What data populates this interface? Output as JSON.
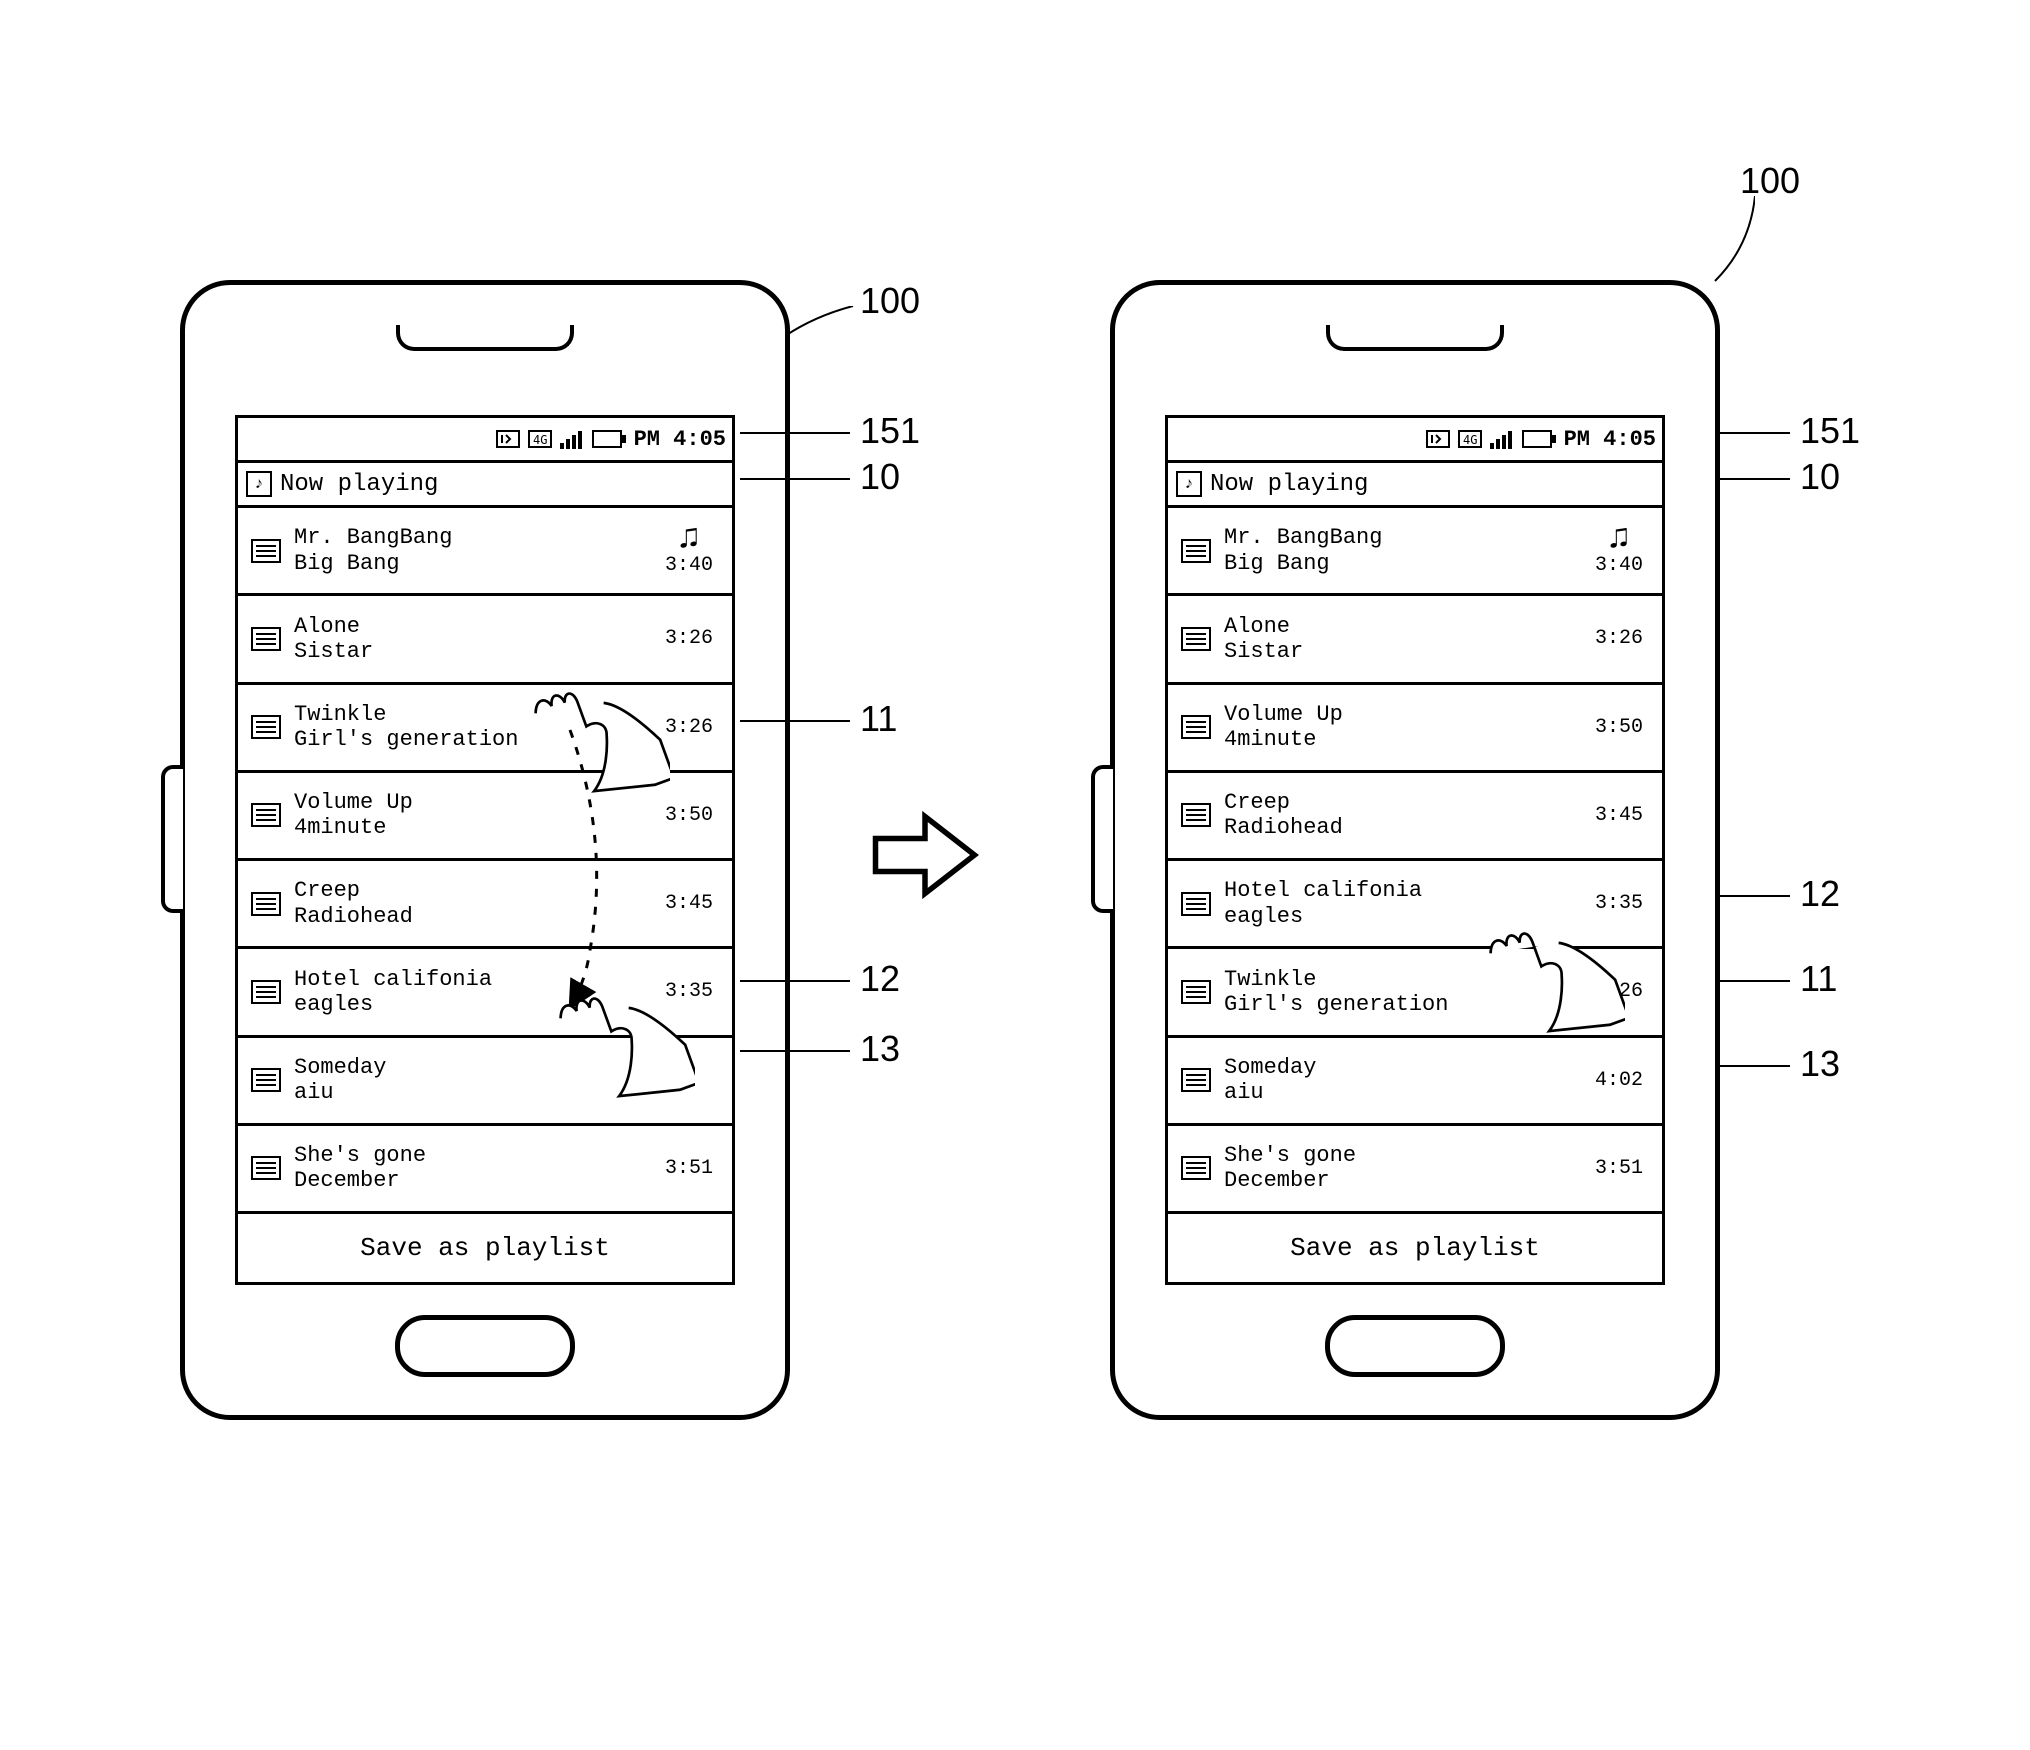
{
  "status": {
    "time": "PM 4:05"
  },
  "header": {
    "now_playing": "Now playing"
  },
  "footer": {
    "save_label": "Save as playlist"
  },
  "callouts": {
    "c100": "100",
    "c151": "151",
    "c10": "10",
    "c11": "11",
    "c12": "12",
    "c13": "13"
  },
  "left": {
    "tracks": [
      {
        "title": "Mr. BangBang",
        "artist": "Big Bang",
        "duration": "3:40",
        "playing": true
      },
      {
        "title": "Alone",
        "artist": "Sistar",
        "duration": "3:26"
      },
      {
        "title": "Twinkle",
        "artist": "Girl's generation",
        "duration": "3:26"
      },
      {
        "title": "Volume Up",
        "artist": "4minute",
        "duration": "3:50"
      },
      {
        "title": "Creep",
        "artist": "Radiohead",
        "duration": "3:45"
      },
      {
        "title": "Hotel califonia",
        "artist": "eagles",
        "duration": "3:35"
      },
      {
        "title": "Someday",
        "artist": "aiu",
        "duration": ""
      },
      {
        "title": "She's gone",
        "artist": "December",
        "duration": "3:51"
      }
    ]
  },
  "right": {
    "tracks": [
      {
        "title": "Mr. BangBang",
        "artist": "Big Bang",
        "duration": "3:40",
        "playing": true
      },
      {
        "title": "Alone",
        "artist": "Sistar",
        "duration": "3:26"
      },
      {
        "title": "Volume Up",
        "artist": "4minute",
        "duration": "3:50"
      },
      {
        "title": "Creep",
        "artist": "Radiohead",
        "duration": "3:45"
      },
      {
        "title": "Hotel califonia",
        "artist": "eagles",
        "duration": "3:35"
      },
      {
        "title": "Twinkle",
        "artist": "Girl's generation",
        "duration": "3:26"
      },
      {
        "title": "Someday",
        "artist": "aiu",
        "duration": "4:02"
      },
      {
        "title": "She's gone",
        "artist": "December",
        "duration": "3:51"
      }
    ]
  }
}
